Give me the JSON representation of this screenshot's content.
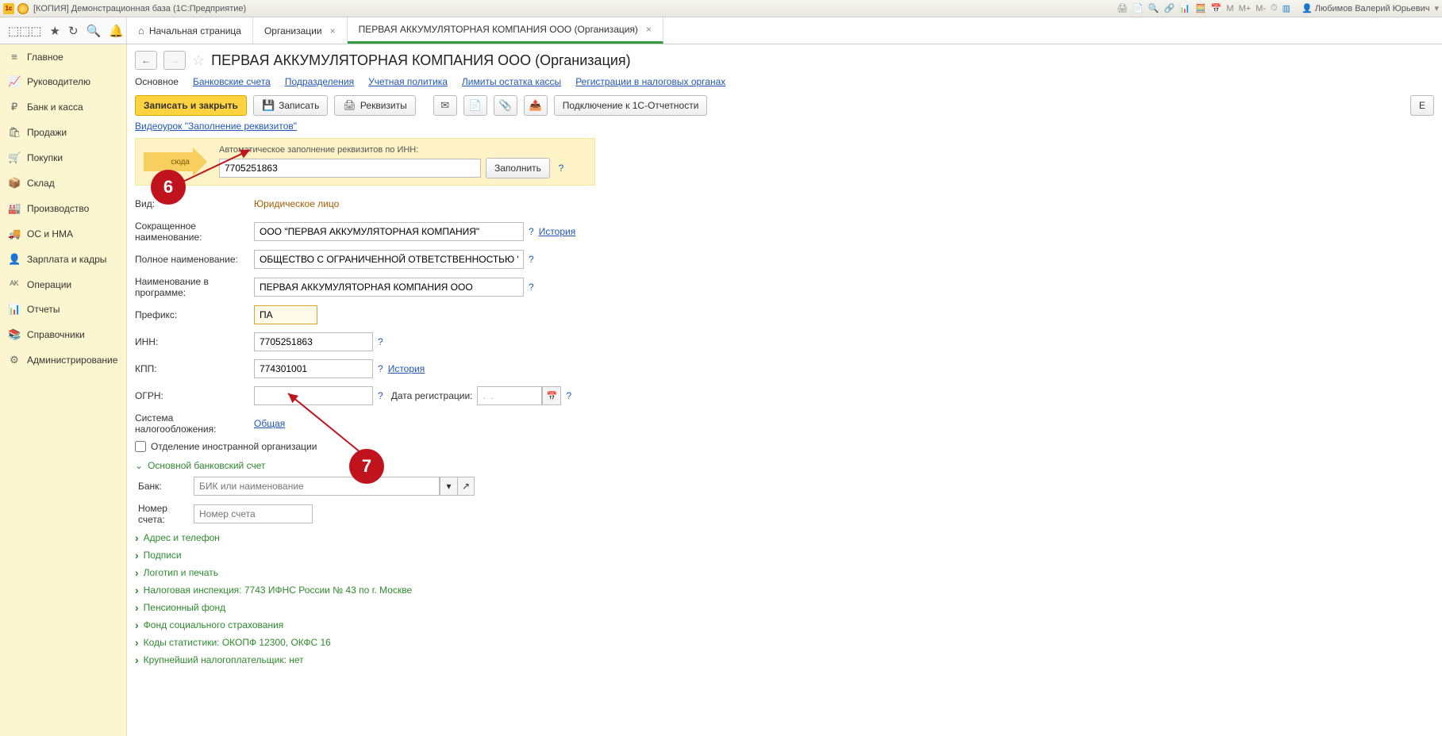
{
  "titlebar": {
    "app_title": "[КОПИЯ] Демонстрационная база  (1С:Предприятие)",
    "user_name": "Любимов Валерий Юрьевич",
    "m_labels": [
      "M",
      "M+",
      "M-"
    ]
  },
  "topnav": {
    "tab_home": "Начальная страница",
    "tab_org": "Организации",
    "tab_current": "ПЕРВАЯ АККУМУЛЯТОРНАЯ КОМПАНИЯ ООО (Организация)"
  },
  "sidebar": {
    "items": [
      {
        "icon": "≡",
        "label": "Главное"
      },
      {
        "icon": "📈",
        "label": "Руководителю"
      },
      {
        "icon": "₽",
        "label": "Банк и касса"
      },
      {
        "icon": "🛍",
        "label": "Продажи"
      },
      {
        "icon": "🛒",
        "label": "Покупки"
      },
      {
        "icon": "📦",
        "label": "Склад"
      },
      {
        "icon": "🏭",
        "label": "Производство"
      },
      {
        "icon": "🚚",
        "label": "ОС и НМА"
      },
      {
        "icon": "👤",
        "label": "Зарплата и кадры"
      },
      {
        "icon": "ᴬᴷ",
        "label": "Операции"
      },
      {
        "icon": "📊",
        "label": "Отчеты"
      },
      {
        "icon": "📚",
        "label": "Справочники"
      },
      {
        "icon": "⚙",
        "label": "Администрирование"
      }
    ]
  },
  "page": {
    "title": "ПЕРВАЯ АККУМУЛЯТОРНАЯ КОМПАНИЯ ООО (Организация)",
    "subtabs": [
      "Основное",
      "Банковские счета",
      "Подразделения",
      "Учетная политика",
      "Лимиты остатка кассы",
      "Регистрации в налоговых органах"
    ],
    "toolbar": {
      "save_close": "Записать и закрыть",
      "save": "Записать",
      "requisites": "Реквизиты",
      "connect_1c": "Подключение к 1С-Отчетности",
      "more": "Е"
    },
    "video_link": "Видеоурок \"Заполнение реквизитов\"",
    "inn_box": {
      "arrow_text": "сюда",
      "caption": "Автоматическое заполнение реквизитов по ИНН:",
      "value": "7705251863",
      "fill_btn": "Заполнить"
    },
    "labels": {
      "vid": "Вид:",
      "vid_value": "Юридическое лицо",
      "short_name": "Сокращенное наименование:",
      "full_name": "Полное наименование:",
      "prog_name": "Наименование в программе:",
      "prefix": "Префикс:",
      "inn": "ИНН:",
      "kpp": "КПП:",
      "ogrn": "ОГРН:",
      "reg_date": "Дата регистрации:",
      "tax_system": "Система налогообложения:",
      "foreign_branch": "Отделение иностранной организации",
      "bank": "Банк:",
      "acct": "Номер счета:",
      "history": "История",
      "tax_value": "Общая"
    },
    "values": {
      "short_name": "ООО \"ПЕРВАЯ АККУМУЛЯТОРНАЯ КОМПАНИЯ\"",
      "full_name": "ОБЩЕСТВО С ОГРАНИЧЕННОЙ ОТВЕТСТВЕННОСТЬЮ \"ПЕРВАЯ",
      "prog_name": "ПЕРВАЯ АККУМУЛЯТОРНАЯ КОМПАНИЯ ООО",
      "prefix": "ПА",
      "inn": "7705251863",
      "kpp": "774301001",
      "ogrn": "",
      "reg_date": ".  .",
      "bank_placeholder": "БИК или наименование",
      "acct_placeholder": "Номер счета"
    },
    "expanders": {
      "bank_account": "Основной банковский счет",
      "address": "Адрес и телефон",
      "signs": "Подписи",
      "logo": "Логотип и печать",
      "tax_insp": "Налоговая инспекция: 7743 ИФНС России № 43 по г. Москве",
      "pension": "Пенсионный фонд",
      "social": "Фонд социального страхования",
      "stats": "Коды статистики: ОКОПФ 12300, ОКФС 16",
      "bigtax": "Крупнейший налогоплательщик: нет"
    }
  },
  "callouts": {
    "c6": "6",
    "c7": "7"
  }
}
